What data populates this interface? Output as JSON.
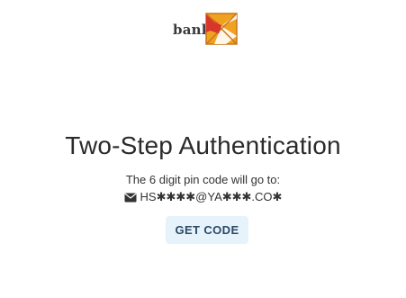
{
  "brand": {
    "logo_text": "bank",
    "logo_tagline": "",
    "icon": "bank-logo-mark"
  },
  "main": {
    "title": "Two-Step Authentication",
    "subtitle": "The 6 digit pin code will go to:",
    "destination_icon": "envelope-icon",
    "destination": "HS✱✱✱✱@YA✱✱✱.CO✱"
  },
  "actions": {
    "get_code_label": "GET CODE"
  },
  "colors": {
    "button_bg": "#e7f3fb",
    "button_text": "#2a4a66",
    "logo_orange": "#f0a11f",
    "logo_red": "#d8362b"
  }
}
